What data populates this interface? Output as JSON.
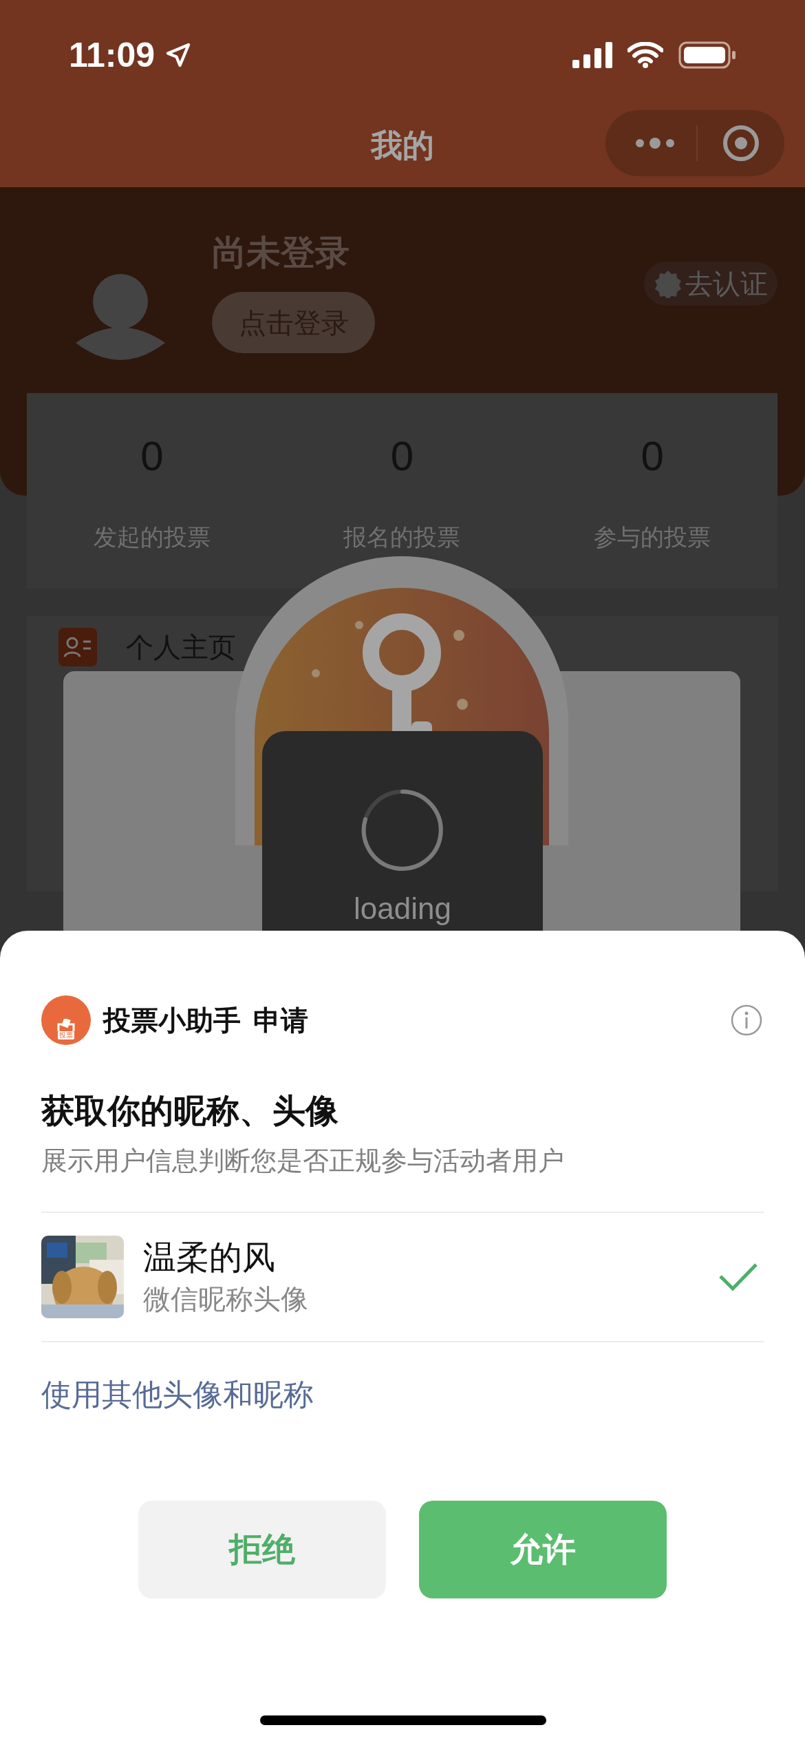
{
  "status_bar": {
    "time": "11:09"
  },
  "nav": {
    "title": "我的"
  },
  "profile": {
    "name": "尚未登录",
    "login_button": "点击登录",
    "verify_button": "去认证"
  },
  "stats": [
    {
      "value": "0",
      "label": "发起的投票"
    },
    {
      "value": "0",
      "label": "报名的投票"
    },
    {
      "value": "0",
      "label": "参与的投票"
    }
  ],
  "menu": [
    {
      "label": "个人主页"
    }
  ],
  "loading": {
    "text": "loading"
  },
  "auth_sheet": {
    "app_icon_label": "投票",
    "app_name": "投票小助手",
    "action": "申请",
    "title": "获取你的昵称、头像",
    "description": "展示用户信息判断您是否正规参与活动者用户",
    "account": {
      "name": "温柔的风",
      "subtitle": "微信昵称头像",
      "selected": true
    },
    "other_link": "使用其他头像和昵称",
    "buttons": [
      {
        "label": "拒绝",
        "kind": "reject"
      },
      {
        "label": "允许",
        "kind": "allow"
      }
    ]
  }
}
